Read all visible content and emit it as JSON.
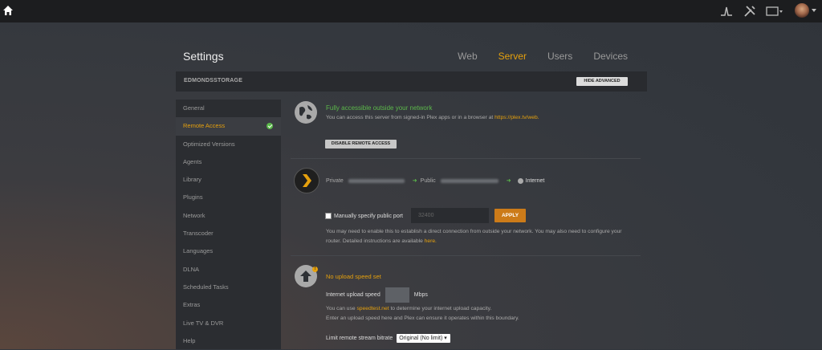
{
  "header": {
    "icons": [
      "home-icon",
      "activity-icon",
      "tools-icon",
      "cast-icon",
      "avatar"
    ]
  },
  "page": {
    "title": "Settings",
    "tabs": [
      {
        "label": "Web",
        "active": false
      },
      {
        "label": "Server",
        "active": true
      },
      {
        "label": "Users",
        "active": false
      },
      {
        "label": "Devices",
        "active": false
      }
    ]
  },
  "server_bar": {
    "name": "EDMONDSSTORAGE",
    "hide_advanced_label": "HIDE ADVANCED"
  },
  "sidebar": {
    "items": [
      {
        "label": "General",
        "active": false
      },
      {
        "label": "Remote Access",
        "active": true,
        "status": "check"
      },
      {
        "label": "Optimized Versions",
        "active": false
      },
      {
        "label": "Agents",
        "active": false
      },
      {
        "label": "Library",
        "active": false
      },
      {
        "label": "Plugins",
        "active": false
      },
      {
        "label": "Network",
        "active": false
      },
      {
        "label": "Transcoder",
        "active": false
      },
      {
        "label": "Languages",
        "active": false
      },
      {
        "label": "DLNA",
        "active": false
      },
      {
        "label": "Scheduled Tasks",
        "active": false
      },
      {
        "label": "Extras",
        "active": false
      },
      {
        "label": "Live TV & DVR",
        "active": false
      },
      {
        "label": "Help",
        "active": false
      }
    ]
  },
  "remote_access": {
    "status": "Fully accessible outside your network",
    "description": "You can access this server from signed-in Plex apps or in a browser at",
    "link": "https://plex.tv/web.",
    "disable_button": "DISABLE REMOTE ACCESS"
  },
  "network": {
    "private_label": "Private",
    "public_label": "Public",
    "internet_label": "Internet",
    "manual_port_label": "Manually specify public port",
    "port_placeholder": "32400",
    "apply_button": "APPLY",
    "note": "You may need to enable this to establish a direct connection from outside your network. You may also need to configure your router. Detailed instructions are available",
    "note_link": "here."
  },
  "upload": {
    "title": "No upload speed set",
    "speed_label": "Internet upload speed",
    "unit": "Mbps",
    "note_prefix": "You can use",
    "note_link": "speedtest.net",
    "note_suffix": "to determine your internet upload capacity.",
    "note_line2": "Enter an upload speed here and Plex can ensure it operates within this boundary.",
    "limit_label": "Limit remote stream bitrate",
    "limit_value": "Original (No limit)"
  },
  "colors": {
    "accent": "#e5a00d",
    "success": "#5bb84a",
    "apply": "#cc7b19"
  }
}
